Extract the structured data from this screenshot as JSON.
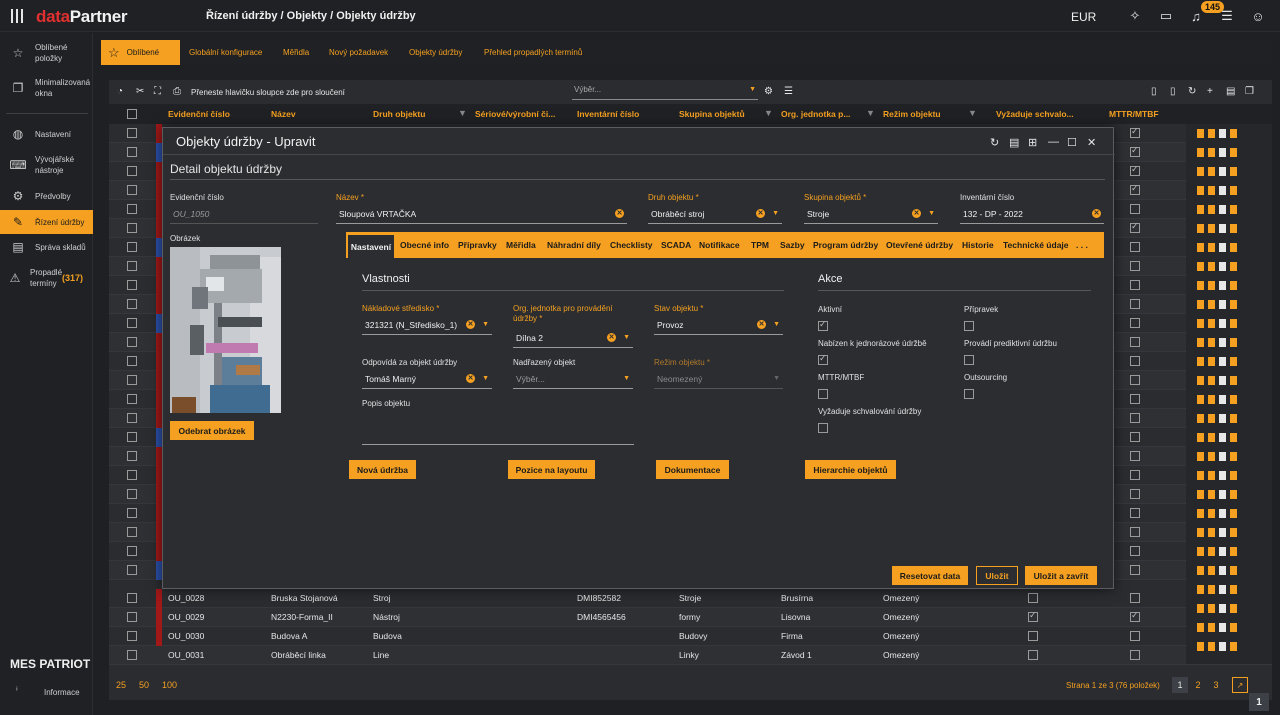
{
  "app": {
    "logo_a": "data",
    "logo_b": "Partner",
    "breadcrumb": "Řízení údržby / Objekty / Objekty údržby",
    "currency": "EUR",
    "notifications": "145"
  },
  "sidebar": {
    "items": [
      {
        "label": "Oblíbené položky",
        "icon": "star-icon"
      },
      {
        "label": "Minimalizovaná okna",
        "icon": "windows-icon"
      },
      {
        "label": "Nastavení",
        "icon": "globe-icon"
      },
      {
        "label": "Vývojářské nástroje",
        "icon": "code-icon"
      },
      {
        "label": "Předvolby",
        "icon": "gear-icon"
      },
      {
        "label": "Řízení údržby",
        "icon": "wrench-icon"
      },
      {
        "label": "Správa skladů",
        "icon": "warehouse-icon"
      },
      {
        "label": "Propadlé termíny",
        "icon": "warning-icon"
      }
    ],
    "overdue_count": "(317)",
    "footer_title": "MES PATRIOT",
    "info_label": "Informace"
  },
  "tabs": [
    "Oblíbené",
    "Globální konfigurace",
    "Měřidla",
    "Nový požadavek",
    "Objekty údržby",
    "Přehled propadlých termínů"
  ],
  "grid": {
    "group_hint": "Přeneste hlavičku sloupce zde pro sloučení",
    "select_placeholder": "Výběr...",
    "columns": [
      "Evidenční číslo",
      "Název",
      "Druh objektu",
      "Sériové/výrobní či...",
      "Inventární číslo",
      "Skupina objektů",
      "Org. jednotka p...",
      "Režim objektu",
      "Vyžaduje schvalo...",
      "MTTR/MTBF"
    ],
    "rows": [
      {
        "id": "OU_0028",
        "name": "Bruska Stojanová",
        "type": "Stroj",
        "serial": "",
        "inv": "DMI852582",
        "group": "Stroje",
        "org": "Brusírna",
        "mode": "Omezený",
        "approve": false,
        "mttr": false
      },
      {
        "id": "OU_0029",
        "name": "N2230-Forma_II",
        "type": "Nástroj",
        "serial": "",
        "inv": "DMI4565456",
        "group": "formy",
        "org": "Lisovna",
        "mode": "Omezený",
        "approve": true,
        "mttr": true
      },
      {
        "id": "OU_0030",
        "name": "Budova A",
        "type": "Budova",
        "serial": "",
        "inv": "",
        "group": "Budovy",
        "org": "Firma",
        "mode": "Omezený",
        "approve": false,
        "mttr": false
      },
      {
        "id": "OU_0031",
        "name": "Obráběcí linka",
        "type": "Line",
        "serial": "",
        "inv": "",
        "group": "Linky",
        "org": "Závod 1",
        "mode": "Omezený",
        "approve": false,
        "mttr": false
      }
    ],
    "page_sizes": [
      "25",
      "50",
      "100"
    ],
    "page_info": "Strana 1 ze 3 (76 položek)",
    "pages": [
      "1",
      "2",
      "3"
    ],
    "corner_badge": "1"
  },
  "modal": {
    "title": "Objekty údržby - Upravit",
    "detail_title": "Detail objektu údržby",
    "fields": {
      "evid_label": "Evidenční číslo",
      "evid_value": "OU_1050",
      "name_label": "Název *",
      "name_value": "Sloupová VRTAČKA",
      "type_label": "Druh objektu *",
      "type_value": "Obráběcí stroj",
      "group_label": "Skupina objektů *",
      "group_value": "Stroje",
      "inv_label": "Inventární číslo",
      "inv_value": "132 - DP - 2022",
      "image_label": "Obrázek"
    },
    "remove_image": "Odebrat obrázek",
    "inner_tabs": [
      "Nastavení",
      "Obecné info",
      "Přípravky",
      "Měřidla",
      "Náhradní díly",
      "Checklisty",
      "SCADA",
      "Notifikace",
      "TPM",
      "Sazby",
      "Program údržby",
      "Otevřené údržby",
      "Historie",
      "Technické údaje",
      ". . ."
    ],
    "props": {
      "title": "Vlastnosti",
      "cost_label": "Nákladové středisko *",
      "cost_value": "321321 (N_Středisko_1)",
      "org_label": "Org. jednotka pro provádění údržby *",
      "org_value": "Dílna 2",
      "state_label": "Stav objektu *",
      "state_value": "Provoz",
      "resp_label": "Odpovídá za objekt údržby",
      "resp_value": "Tomáš Marný",
      "parent_label": "Nadřazený objekt",
      "parent_value": "Výběr...",
      "mode_label": "Režim objektu *",
      "mode_value": "Neomezený",
      "desc_label": "Popis objektu"
    },
    "actions": {
      "title": "Akce",
      "active": "Aktivní",
      "active_checked": true,
      "fixture": "Přípravek",
      "fixture_checked": false,
      "oneoff": "Nabízen k jednorázové údržbě",
      "oneoff_checked": true,
      "predictive": "Provádí prediktivní údržbu",
      "predictive_checked": false,
      "mttr": "MTTR/MTBF",
      "mttr_checked": false,
      "outsourcing": "Outsourcing",
      "outsourcing_checked": false,
      "approval": "Vyžaduje schvalování údržby",
      "approval_checked": false
    },
    "buttons": {
      "new_maint": "Nová údržba",
      "layout_pos": "Pozice na layoutu",
      "docs": "Dokumentace",
      "hierarchy": "Hierarchie objektů",
      "reset": "Resetovat data",
      "save": "Uložit",
      "save_close": "Uložit a zavřít"
    }
  }
}
